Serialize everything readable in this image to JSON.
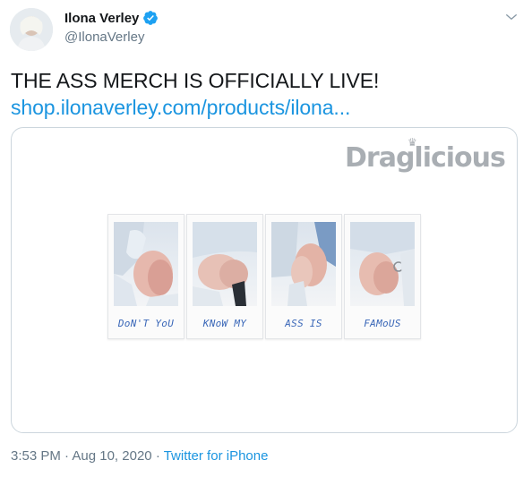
{
  "author": {
    "display_name": "Ilona Verley",
    "handle": "@IlonaVerley",
    "avatar_icon": "profile-avatar",
    "verified_icon": "verified-badge-icon",
    "verified_color": "#1da1f2"
  },
  "tweet": {
    "text": "THE ASS MERCH IS OFFICIALLY LIVE!",
    "link_text": "shop.ilonaverley.com/products/ilona..."
  },
  "media": {
    "watermark": "Draglicious",
    "captions": [
      "DoN'T YoU",
      "KNoW MY",
      "ASS IS",
      "FAMoUS"
    ]
  },
  "footer": {
    "time": "3:53 PM",
    "separator_1": "·",
    "date": "Aug 10, 2020",
    "separator_2": "·",
    "source": "Twitter for iPhone"
  },
  "colors": {
    "link": "#1b95e0",
    "muted": "#657786",
    "text": "#14171a",
    "caption_ink": "#3a67b8"
  }
}
